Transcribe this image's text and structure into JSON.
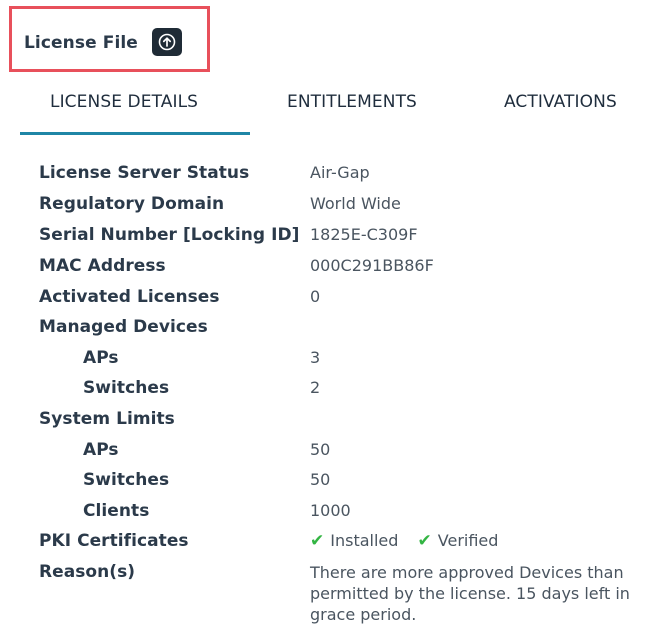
{
  "license_file": {
    "title": "License File",
    "upload_icon": "upload-circle-arrow-icon"
  },
  "tabs": [
    {
      "label": "LICENSE DETAILS",
      "active": true
    },
    {
      "label": "ENTITLEMENTS",
      "active": false
    },
    {
      "label": "ACTIVATIONS",
      "active": false
    }
  ],
  "colors": {
    "highlight_border": "#e8505b",
    "active_tab_underline": "#1f86a6",
    "check": "#33b543"
  },
  "details": {
    "license_server_status": {
      "label": "License Server Status",
      "value": "Air-Gap"
    },
    "regulatory_domain": {
      "label": "Regulatory Domain",
      "value": "World Wide"
    },
    "serial_number": {
      "label": "Serial Number [Locking ID]",
      "value": "1825E-C309F"
    },
    "mac_address": {
      "label": "MAC Address",
      "value": "000C291BB86F"
    },
    "activated_licenses": {
      "label": "Activated Licenses",
      "value": "0"
    },
    "managed_devices": {
      "label": "Managed Devices",
      "aps": {
        "label": "APs",
        "value": "3"
      },
      "switches": {
        "label": "Switches",
        "value": "2"
      }
    },
    "system_limits": {
      "label": "System Limits",
      "aps": {
        "label": "APs",
        "value": "50"
      },
      "switches": {
        "label": "Switches",
        "value": "50"
      },
      "clients": {
        "label": "Clients",
        "value": "1000"
      }
    },
    "pki_certificates": {
      "label": "PKI Certificates",
      "installed": "Installed",
      "verified": "Verified"
    },
    "reasons": {
      "label": "Reason(s)",
      "value": "There are more approved Devices than permitted by the license. 15 days left in grace period."
    }
  }
}
